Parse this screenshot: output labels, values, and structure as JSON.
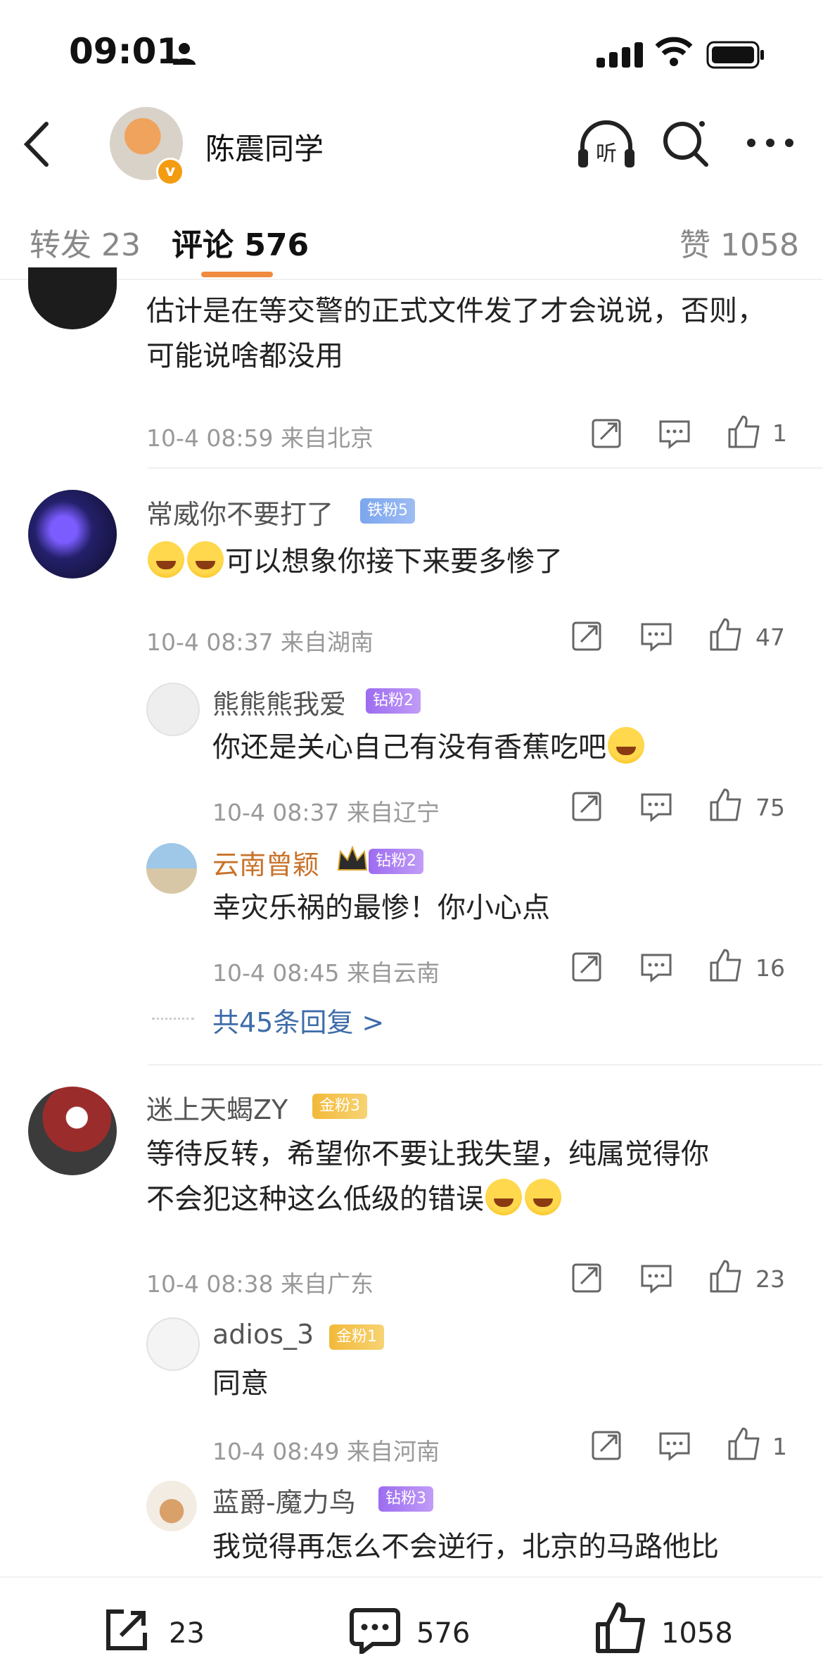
{
  "status_bar": {
    "time": "09:01"
  },
  "header": {
    "username": "陈震同学"
  },
  "tabs": {
    "repost": "转发 23",
    "comments": "评论 576",
    "likes": "赞 1058"
  },
  "comments": [
    {
      "text": "估计是在等交警的正式文件发了才会说说，否则，可能说啥都没用",
      "time": "10-4 08:59",
      "location": "来自北京",
      "likes": "1"
    },
    {
      "user": "常威你不要打了",
      "badge": "铁粉5",
      "text": "可以想象你接下来要多惨了",
      "time": "10-4 08:37",
      "location": "来自湖南",
      "likes": "47",
      "replies": [
        {
          "user": "熊熊熊我爱",
          "badge": "钻粉2",
          "text": "你还是关心自己有没有香蕉吃吧",
          "time": "10-4 08:37",
          "location": "来自辽宁",
          "likes": "75"
        },
        {
          "user": "云南曾颖",
          "badge": "钻粉2",
          "text": "幸灾乐祸的最惨！你小心点",
          "time": "10-4 08:45",
          "location": "来自云南",
          "likes": "16"
        }
      ],
      "more_replies": "共45条回复 >"
    },
    {
      "user": "迷上天蝎ZY",
      "badge": "金粉3",
      "text_line1": "等待反转，希望你不要让我失望，纯属觉得你",
      "text_line2": "不会犯这种这么低级的错误",
      "time": "10-4 08:38",
      "location": "来自广东",
      "likes": "23",
      "replies": [
        {
          "user": "adios_3",
          "badge": "金粉1",
          "text": "同意",
          "time": "10-4 08:49",
          "location": "来自河南",
          "likes": "1"
        },
        {
          "user": "蓝爵-魔力鸟",
          "badge": "钻粉3",
          "text": "我觉得再怎么不会逆行，北京的马路他比"
        }
      ]
    }
  ],
  "bottom_bar": {
    "repost_count": "23",
    "comment_count": "576",
    "like_count": "1058"
  },
  "colors": {
    "accent": "#f08a3e",
    "link": "#3d6ca8",
    "gold_name": "#c8732a"
  },
  "icons": [
    "person-icon",
    "signal-icon",
    "wifi-icon",
    "battery-icon",
    "back-icon",
    "verified-icon",
    "listen-icon",
    "search-icon",
    "more-icon",
    "share-icon",
    "comment-icon",
    "like-icon"
  ]
}
